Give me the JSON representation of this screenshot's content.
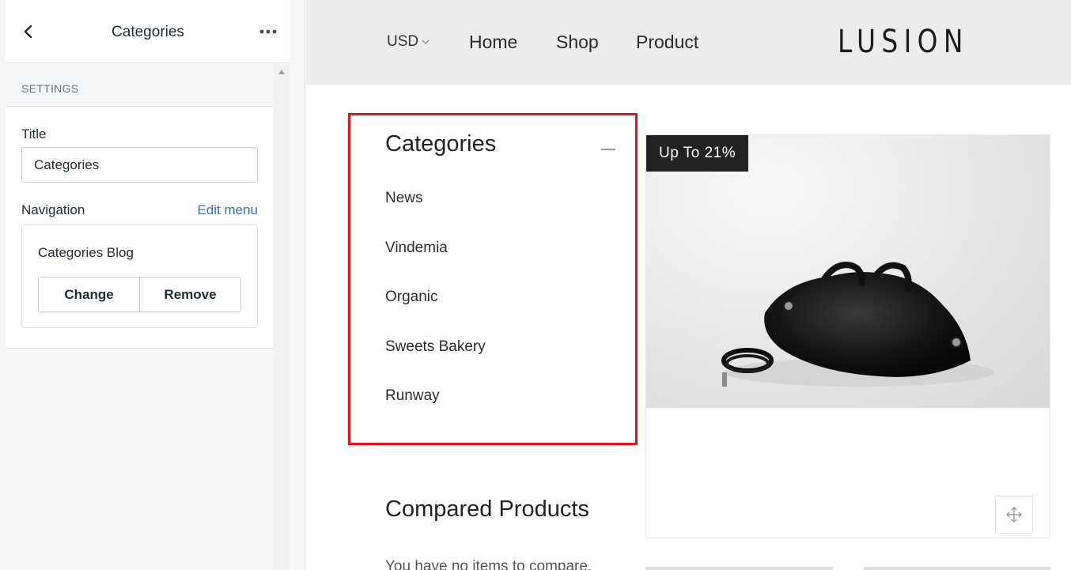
{
  "editor": {
    "header_title": "Categories",
    "section_label": "SETTINGS",
    "title_field_label": "Title",
    "title_field_value": "Categories",
    "navigation_label": "Navigation",
    "edit_menu_link": "Edit menu",
    "menu_name": "Categories Blog",
    "change_button": "Change",
    "remove_button": "Remove",
    "icons": {
      "back": "chevron-left-icon",
      "more": "more-horizontal-icon"
    }
  },
  "store": {
    "currency": "USD",
    "nav": [
      "Home",
      "Shop",
      "Product"
    ],
    "brand": "LUSION",
    "categories_widget": {
      "title": "Categories",
      "items": [
        "News",
        "Vindemia",
        "Organic",
        "Sweets Bakery",
        "Runway"
      ]
    },
    "compared_products": {
      "title": "Compared Products",
      "empty_text": "You have no items to compare."
    },
    "product": {
      "badge": "Up To 21%",
      "image_subject": "black leather bag with strap",
      "zoom_icon": "move-arrows-icon"
    },
    "colors": {
      "highlight": "#e0141c",
      "header_bg": "#ebecee",
      "link_blue": "#3a70b5",
      "badge_bg": "#222222"
    }
  }
}
